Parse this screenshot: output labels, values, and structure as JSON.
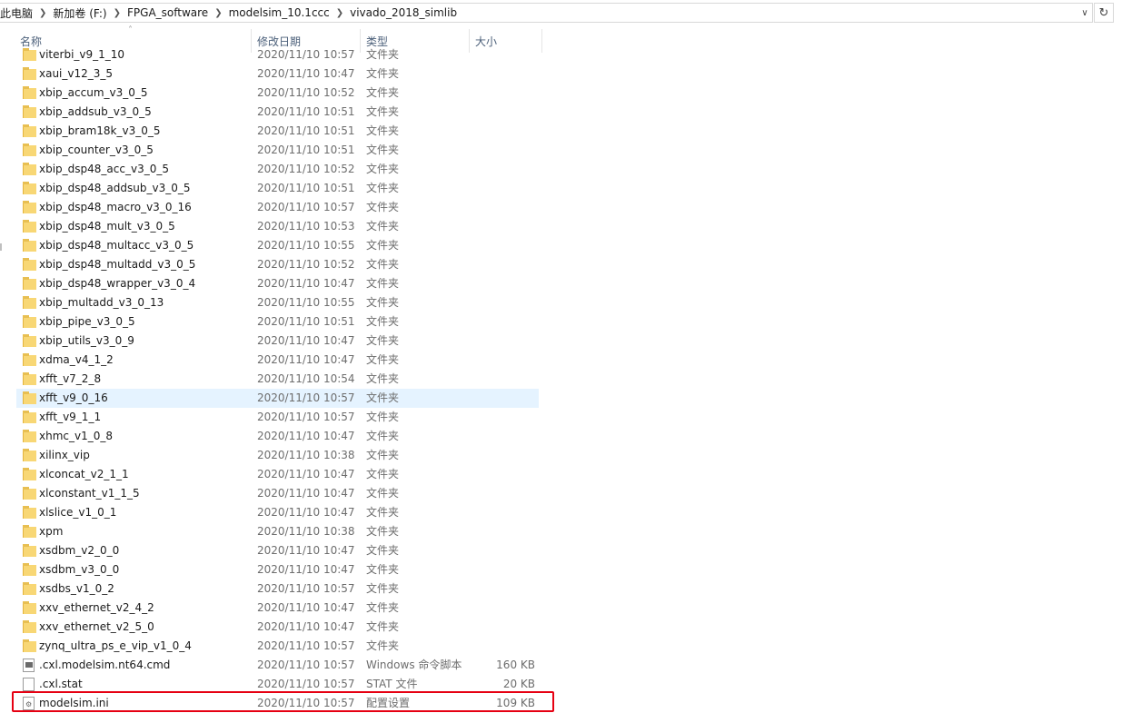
{
  "breadcrumb": [
    "此电脑",
    "新加卷 (F:)",
    "FPGA_software",
    "modelsim_10.1ccc",
    "vivado_2018_simlib"
  ],
  "columns": {
    "name": "名称",
    "date": "修改日期",
    "type": "类型",
    "size": "大小"
  },
  "rows": [
    {
      "name": "viterbi_v9_1_10",
      "date": "2020/11/10 10:57",
      "type": "文件夹",
      "size": "",
      "icon": "folder-icon"
    },
    {
      "name": "xaui_v12_3_5",
      "date": "2020/11/10 10:47",
      "type": "文件夹",
      "size": "",
      "icon": "folder-icon"
    },
    {
      "name": "xbip_accum_v3_0_5",
      "date": "2020/11/10 10:52",
      "type": "文件夹",
      "size": "",
      "icon": "folder-icon"
    },
    {
      "name": "xbip_addsub_v3_0_5",
      "date": "2020/11/10 10:51",
      "type": "文件夹",
      "size": "",
      "icon": "folder-icon"
    },
    {
      "name": "xbip_bram18k_v3_0_5",
      "date": "2020/11/10 10:51",
      "type": "文件夹",
      "size": "",
      "icon": "folder-icon"
    },
    {
      "name": "xbip_counter_v3_0_5",
      "date": "2020/11/10 10:51",
      "type": "文件夹",
      "size": "",
      "icon": "folder-icon"
    },
    {
      "name": "xbip_dsp48_acc_v3_0_5",
      "date": "2020/11/10 10:52",
      "type": "文件夹",
      "size": "",
      "icon": "folder-icon"
    },
    {
      "name": "xbip_dsp48_addsub_v3_0_5",
      "date": "2020/11/10 10:51",
      "type": "文件夹",
      "size": "",
      "icon": "folder-icon"
    },
    {
      "name": "xbip_dsp48_macro_v3_0_16",
      "date": "2020/11/10 10:57",
      "type": "文件夹",
      "size": "",
      "icon": "folder-icon"
    },
    {
      "name": "xbip_dsp48_mult_v3_0_5",
      "date": "2020/11/10 10:53",
      "type": "文件夹",
      "size": "",
      "icon": "folder-icon"
    },
    {
      "name": "xbip_dsp48_multacc_v3_0_5",
      "date": "2020/11/10 10:55",
      "type": "文件夹",
      "size": "",
      "icon": "folder-icon"
    },
    {
      "name": "xbip_dsp48_multadd_v3_0_5",
      "date": "2020/11/10 10:52",
      "type": "文件夹",
      "size": "",
      "icon": "folder-icon"
    },
    {
      "name": "xbip_dsp48_wrapper_v3_0_4",
      "date": "2020/11/10 10:47",
      "type": "文件夹",
      "size": "",
      "icon": "folder-icon"
    },
    {
      "name": "xbip_multadd_v3_0_13",
      "date": "2020/11/10 10:55",
      "type": "文件夹",
      "size": "",
      "icon": "folder-icon"
    },
    {
      "name": "xbip_pipe_v3_0_5",
      "date": "2020/11/10 10:51",
      "type": "文件夹",
      "size": "",
      "icon": "folder-icon"
    },
    {
      "name": "xbip_utils_v3_0_9",
      "date": "2020/11/10 10:47",
      "type": "文件夹",
      "size": "",
      "icon": "folder-icon"
    },
    {
      "name": "xdma_v4_1_2",
      "date": "2020/11/10 10:47",
      "type": "文件夹",
      "size": "",
      "icon": "folder-icon"
    },
    {
      "name": "xfft_v7_2_8",
      "date": "2020/11/10 10:54",
      "type": "文件夹",
      "size": "",
      "icon": "folder-icon"
    },
    {
      "name": "xfft_v9_0_16",
      "date": "2020/11/10 10:57",
      "type": "文件夹",
      "size": "",
      "icon": "folder-icon",
      "selected": true
    },
    {
      "name": "xfft_v9_1_1",
      "date": "2020/11/10 10:57",
      "type": "文件夹",
      "size": "",
      "icon": "folder-icon"
    },
    {
      "name": "xhmc_v1_0_8",
      "date": "2020/11/10 10:47",
      "type": "文件夹",
      "size": "",
      "icon": "folder-icon"
    },
    {
      "name": "xilinx_vip",
      "date": "2020/11/10 10:38",
      "type": "文件夹",
      "size": "",
      "icon": "folder-icon"
    },
    {
      "name": "xlconcat_v2_1_1",
      "date": "2020/11/10 10:47",
      "type": "文件夹",
      "size": "",
      "icon": "folder-icon"
    },
    {
      "name": "xlconstant_v1_1_5",
      "date": "2020/11/10 10:47",
      "type": "文件夹",
      "size": "",
      "icon": "folder-icon"
    },
    {
      "name": "xlslice_v1_0_1",
      "date": "2020/11/10 10:47",
      "type": "文件夹",
      "size": "",
      "icon": "folder-icon"
    },
    {
      "name": "xpm",
      "date": "2020/11/10 10:38",
      "type": "文件夹",
      "size": "",
      "icon": "folder-icon"
    },
    {
      "name": "xsdbm_v2_0_0",
      "date": "2020/11/10 10:47",
      "type": "文件夹",
      "size": "",
      "icon": "folder-icon"
    },
    {
      "name": "xsdbm_v3_0_0",
      "date": "2020/11/10 10:47",
      "type": "文件夹",
      "size": "",
      "icon": "folder-icon"
    },
    {
      "name": "xsdbs_v1_0_2",
      "date": "2020/11/10 10:57",
      "type": "文件夹",
      "size": "",
      "icon": "folder-icon"
    },
    {
      "name": "xxv_ethernet_v2_4_2",
      "date": "2020/11/10 10:47",
      "type": "文件夹",
      "size": "",
      "icon": "folder-icon"
    },
    {
      "name": "xxv_ethernet_v2_5_0",
      "date": "2020/11/10 10:47",
      "type": "文件夹",
      "size": "",
      "icon": "folder-icon"
    },
    {
      "name": "zynq_ultra_ps_e_vip_v1_0_4",
      "date": "2020/11/10 10:57",
      "type": "文件夹",
      "size": "",
      "icon": "folder-icon"
    },
    {
      "name": ".cxl.modelsim.nt64.cmd",
      "date": "2020/11/10 10:57",
      "type": "Windows 命令脚本",
      "size": "160 KB",
      "icon": "cmd-file-icon"
    },
    {
      "name": ".cxl.stat",
      "date": "2020/11/10 10:57",
      "type": "STAT 文件",
      "size": "20 KB",
      "icon": "blank-file-icon"
    },
    {
      "name": "modelsim.ini",
      "date": "2020/11/10 10:57",
      "type": "配置设置",
      "size": "109 KB",
      "icon": "settings-file-icon"
    }
  ],
  "colors": {
    "selected_row": "#e5f3ff",
    "highlight_border": "#e60012",
    "folder": "#f8d775"
  }
}
